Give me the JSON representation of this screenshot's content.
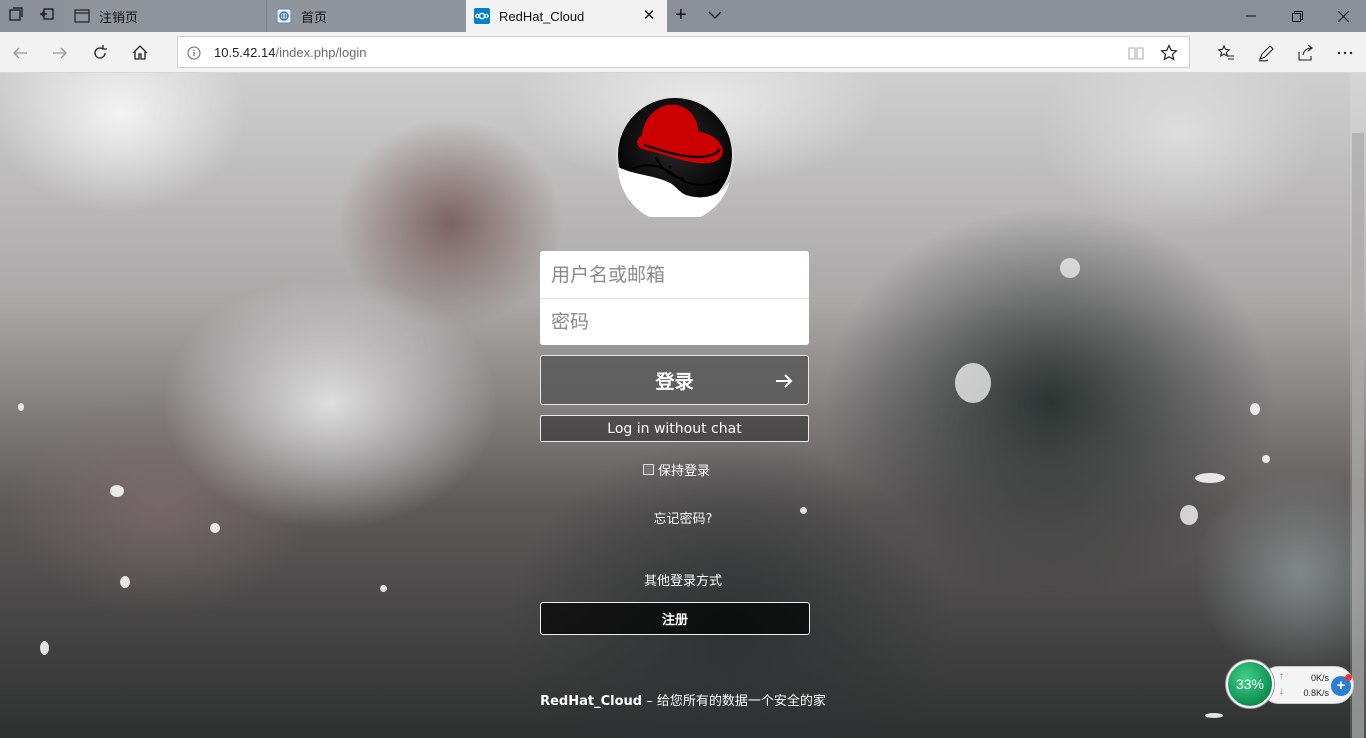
{
  "browser": {
    "tabs": [
      {
        "title": "注销页",
        "icon": "page-icon",
        "active": false
      },
      {
        "title": "首页",
        "icon": "globe-icon",
        "active": false
      },
      {
        "title": "RedHat_Cloud",
        "icon": "nextcloud-icon",
        "active": true
      }
    ],
    "url_host": "10.5.42.14",
    "url_path": "/index.php/login"
  },
  "login": {
    "username_placeholder": "用户名或邮箱",
    "password_placeholder": "密码",
    "submit_label": "登录",
    "nochat_label": "Log in without chat",
    "remember_label": "保持登录",
    "lost_password": "忘记密码?",
    "alternative_logins": "其他登录方式",
    "register_label": "注册"
  },
  "footer": {
    "brand": "RedHat_Cloud",
    "slogan": " – 给您所有的数据一个安全的家"
  },
  "netmon": {
    "percent": "33%",
    "upload": "0K/s",
    "download": "0.8K/s"
  },
  "colors": {
    "logo_red": "#cc0000",
    "nextcloud_blue": "#0082c9",
    "netmon_green": "#1fa560"
  }
}
